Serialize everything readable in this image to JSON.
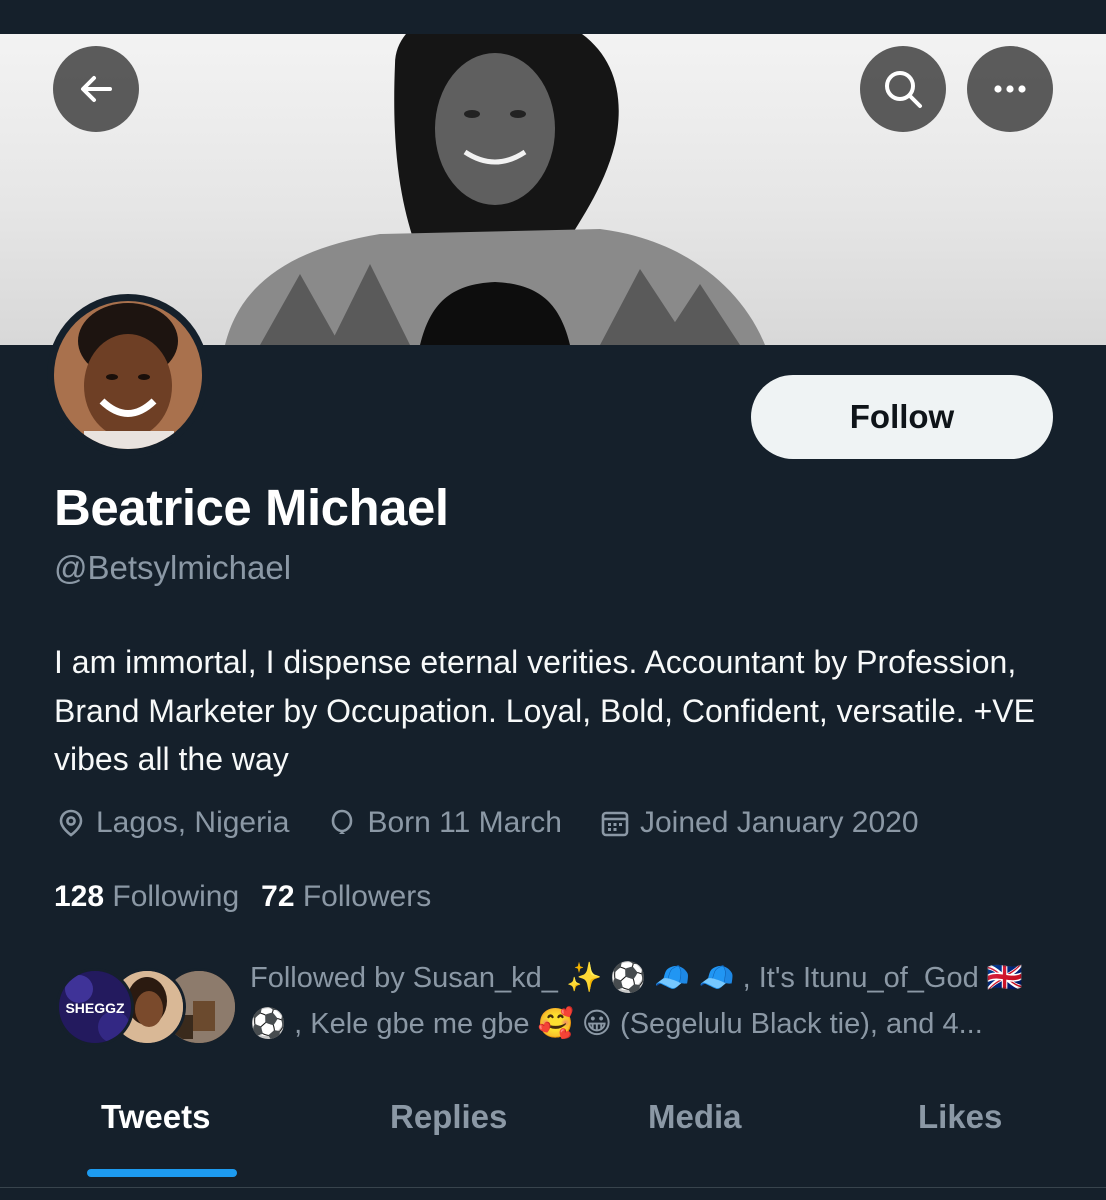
{
  "header": {
    "back_icon": "arrow-left-icon",
    "search_icon": "search-icon",
    "more_icon": "more-horizontal-icon"
  },
  "profile": {
    "name": "Beatrice Michael",
    "handle": "@Betsylmichael",
    "bio": "I am immortal, I dispense eternal verities. Accountant by Profession, Brand Marketer by Occupation. Loyal, Bold, Confident, versatile. +VE vibes all the way",
    "follow_label": "Follow",
    "location": "Lagos, Nigeria",
    "birthday": "Born 11 March",
    "joined": "Joined January 2020"
  },
  "stats": {
    "following_count": "128",
    "following_label": "Following",
    "followers_count": "72",
    "followers_label": "Followers"
  },
  "followed_by": {
    "text": "Followed by Susan_kd_ ✨ ⚽ 🧢 🧢 , It's Itunu_of_God 🇬🇧 ⚽ , Kele gbe me gbe 🥰 😀 (Segelulu Black tie), and 4...",
    "avatar_label": "SHEGGZ"
  },
  "tabs": [
    {
      "label": "Tweets",
      "active": true
    },
    {
      "label": "Replies",
      "active": false
    },
    {
      "label": "Media",
      "active": false
    },
    {
      "label": "Likes",
      "active": false
    }
  ],
  "colors": {
    "background": "#15202b",
    "accent": "#1d9bf0",
    "secondary_text": "#8b98a5",
    "follow_button": "#eff3f4"
  }
}
